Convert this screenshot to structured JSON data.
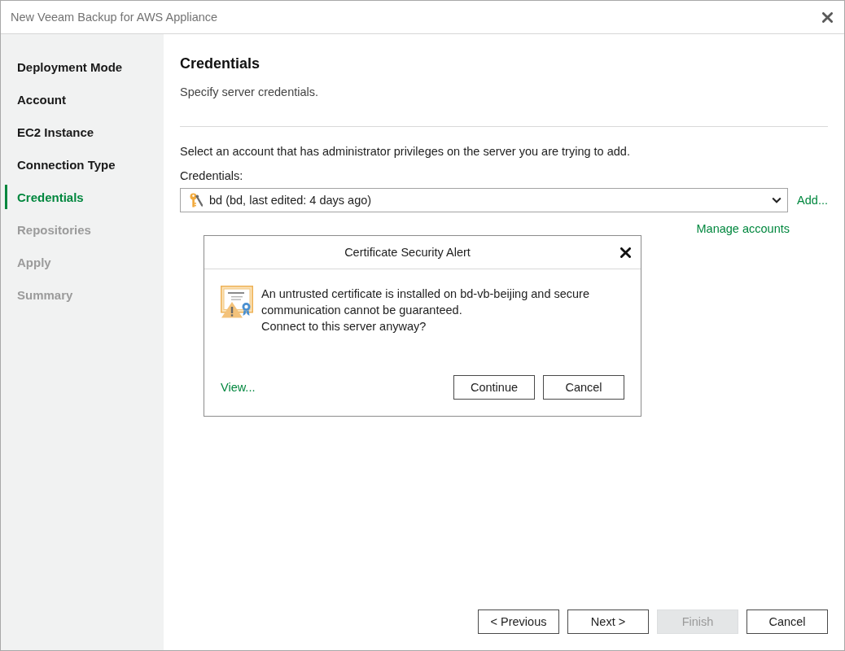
{
  "window": {
    "title": "New Veeam Backup for AWS Appliance"
  },
  "steps": [
    {
      "label": "Deployment Mode",
      "selected": false,
      "disabled": false
    },
    {
      "label": "Account",
      "selected": false,
      "disabled": false
    },
    {
      "label": "EC2 Instance",
      "selected": false,
      "disabled": false
    },
    {
      "label": "Connection Type",
      "selected": false,
      "disabled": false
    },
    {
      "label": "Credentials",
      "selected": true,
      "disabled": false
    },
    {
      "label": "Repositories",
      "selected": false,
      "disabled": true
    },
    {
      "label": "Apply",
      "selected": false,
      "disabled": true
    },
    {
      "label": "Summary",
      "selected": false,
      "disabled": true
    }
  ],
  "page": {
    "title": "Credentials",
    "subtitle": "Specify server credentials.",
    "instruction": "Select an account that has administrator privileges on the server you are trying to add.",
    "credentials": {
      "label": "Credentials:",
      "value": "bd (bd, last edited: 4 days ago)"
    },
    "add_link": "Add...",
    "manage_link": "Manage accounts"
  },
  "dialog": {
    "title": "Certificate Security Alert",
    "message": "An untrusted certificate is installed on bd-vb-beijing and secure communication cannot be guaranteed.",
    "question": "Connect to this server anyway?",
    "view_link": "View...",
    "buttons": [
      {
        "label": "Continue"
      },
      {
        "label": "Cancel"
      }
    ]
  },
  "buttons": [
    {
      "label": "< Previous",
      "disabled": false
    },
    {
      "label": "Next >",
      "disabled": false
    },
    {
      "label": "Finish",
      "disabled": true
    },
    {
      "label": "Cancel",
      "disabled": false
    }
  ]
}
